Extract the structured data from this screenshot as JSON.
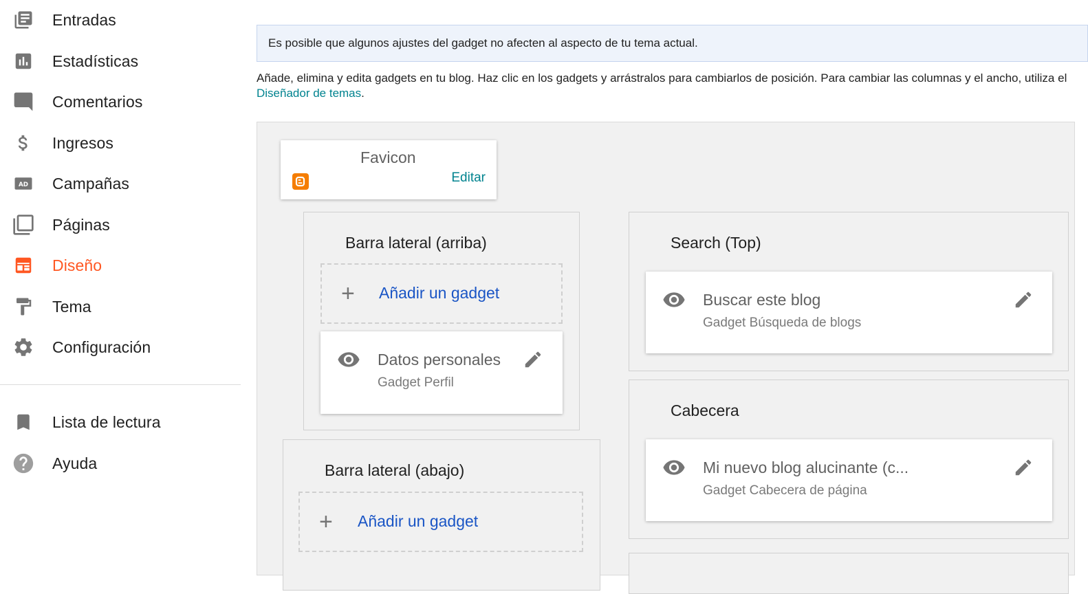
{
  "sidebar": {
    "items": [
      {
        "label": "Entradas",
        "icon": "posts-icon"
      },
      {
        "label": "Estadísticas",
        "icon": "stats-icon"
      },
      {
        "label": "Comentarios",
        "icon": "comment-icon"
      },
      {
        "label": "Ingresos",
        "icon": "dollar-icon"
      },
      {
        "label": "Campañas",
        "icon": "ad-icon"
      },
      {
        "label": "Páginas",
        "icon": "pages-icon"
      },
      {
        "label": "Diseño",
        "icon": "layout-icon",
        "active": true
      },
      {
        "label": "Tema",
        "icon": "paint-roller-icon"
      },
      {
        "label": "Configuración",
        "icon": "gear-icon"
      }
    ],
    "secondary": [
      {
        "label": "Lista de lectura",
        "icon": "bookmark-icon"
      },
      {
        "label": "Ayuda",
        "icon": "help-icon"
      }
    ]
  },
  "notice": "Es posible que algunos ajustes del gadget no afecten al aspecto de tu tema actual.",
  "description": {
    "text": "Añade, elimina y edita gadgets en tu blog. Haz clic en los gadgets y arrástralos para cambiarlos de posición. Para cambiar las columnas y el ancho, utiliza el",
    "link": "Diseñador de temas",
    "tail": "."
  },
  "favicon": {
    "title": "Favicon",
    "edit": "Editar"
  },
  "sections": {
    "sidebar_top": {
      "title": "Barra lateral (arriba)",
      "add": "Añadir un gadget",
      "gadget": {
        "title": "Datos personales",
        "subtitle": "Gadget Perfil"
      }
    },
    "sidebar_bottom": {
      "title": "Barra lateral (abajo)",
      "add": "Añadir un gadget"
    },
    "search_top": {
      "title": "Search (Top)",
      "gadget": {
        "title": "Buscar este blog",
        "subtitle": "Gadget Búsqueda de blogs"
      }
    },
    "header": {
      "title": "Cabecera",
      "gadget": {
        "title": "Mi nuevo blog alucinante (c...",
        "subtitle": "Gadget Cabecera de página"
      }
    }
  },
  "colors": {
    "accent": "#ff5722",
    "link": "#1a55c5",
    "teal_link": "#00838f",
    "icon_grey": "#757575",
    "blogger_orange": "#f57d00"
  }
}
